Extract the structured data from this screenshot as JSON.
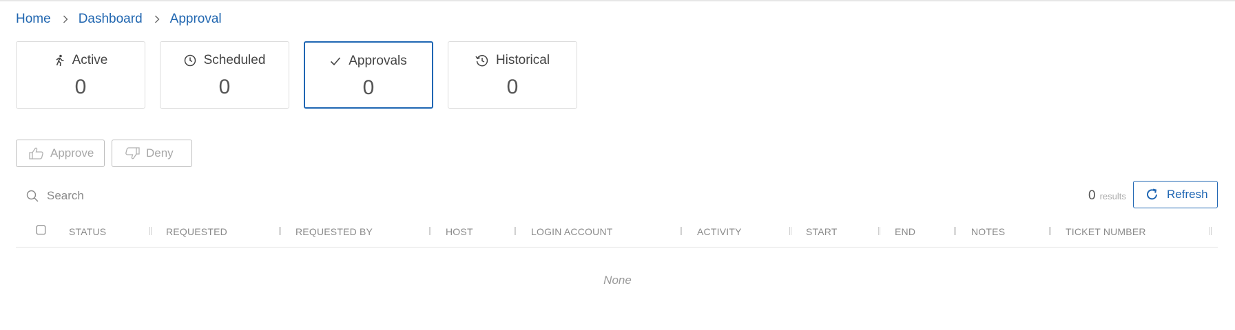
{
  "breadcrumb": [
    "Home",
    "Dashboard",
    "Approval"
  ],
  "cards": [
    {
      "label": "Active",
      "count": "0",
      "icon": "running-person-icon"
    },
    {
      "label": "Scheduled",
      "count": "0",
      "icon": "clock-icon"
    },
    {
      "label": "Approvals",
      "count": "0",
      "icon": "check-icon"
    },
    {
      "label": "Historical",
      "count": "0",
      "icon": "history-icon"
    }
  ],
  "actions": {
    "approve_label": "Approve",
    "deny_label": "Deny"
  },
  "search": {
    "placeholder": "Search",
    "value": ""
  },
  "results": {
    "count": "0",
    "label": "results"
  },
  "refresh_label": "Refresh",
  "table": {
    "columns": [
      "STATUS",
      "REQUESTED",
      "REQUESTED BY",
      "HOST",
      "LOGIN ACCOUNT",
      "ACTIVITY",
      "START",
      "END",
      "NOTES",
      "TICKET NUMBER"
    ],
    "empty_text": "None"
  },
  "colors": {
    "accent": "#1f66b3",
    "link": "#2066b0"
  }
}
